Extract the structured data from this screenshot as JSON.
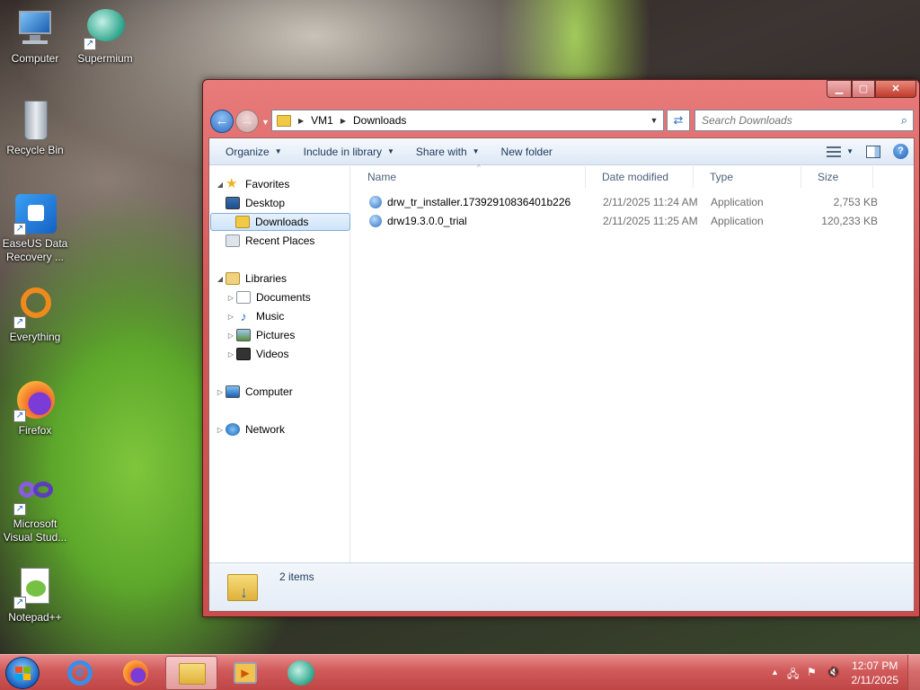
{
  "desktop": {
    "icons": [
      {
        "label": "Computer"
      },
      {
        "label": "Supermium"
      },
      {
        "label": "Recycle Bin"
      },
      {
        "label": "EaseUS Data Recovery ..."
      },
      {
        "label": "Everything"
      },
      {
        "label": "Firefox"
      },
      {
        "label": "Microsoft Visual Stud..."
      },
      {
        "label": "Notepad++"
      }
    ]
  },
  "window": {
    "controls": {
      "minimize": "▁",
      "maximize": "▢",
      "close": "✕"
    },
    "breadcrumb": [
      "VM1",
      "Downloads"
    ],
    "search": {
      "placeholder": "Search Downloads"
    },
    "toolbar": {
      "organize": "Organize",
      "include_in_library": "Include in library",
      "share_with": "Share with",
      "new_folder": "New folder"
    },
    "nav": {
      "favorites": "Favorites",
      "desktop": "Desktop",
      "downloads": "Downloads",
      "recent_places": "Recent Places",
      "libraries": "Libraries",
      "documents": "Documents",
      "music": "Music",
      "pictures": "Pictures",
      "videos": "Videos",
      "computer": "Computer",
      "network": "Network"
    },
    "columns": {
      "name": "Name",
      "date_modified": "Date modified",
      "type": "Type",
      "size": "Size"
    },
    "files": [
      {
        "name": "drw_tr_installer.17392910836401b226",
        "date": "2/11/2025 11:24 AM",
        "type": "Application",
        "size": "2,753 KB"
      },
      {
        "name": "drw19.3.0.0_trial",
        "date": "2/11/2025 11:25 AM",
        "type": "Application",
        "size": "120,233 KB"
      }
    ],
    "details": {
      "count": "2 items"
    }
  },
  "taskbar": {
    "clock": {
      "time": "12:07 PM",
      "date": "2/11/2025"
    }
  },
  "colors": {
    "window_frame": "#d25a5a",
    "taskbar": "#d05959",
    "accent": "#2e6fc3"
  }
}
